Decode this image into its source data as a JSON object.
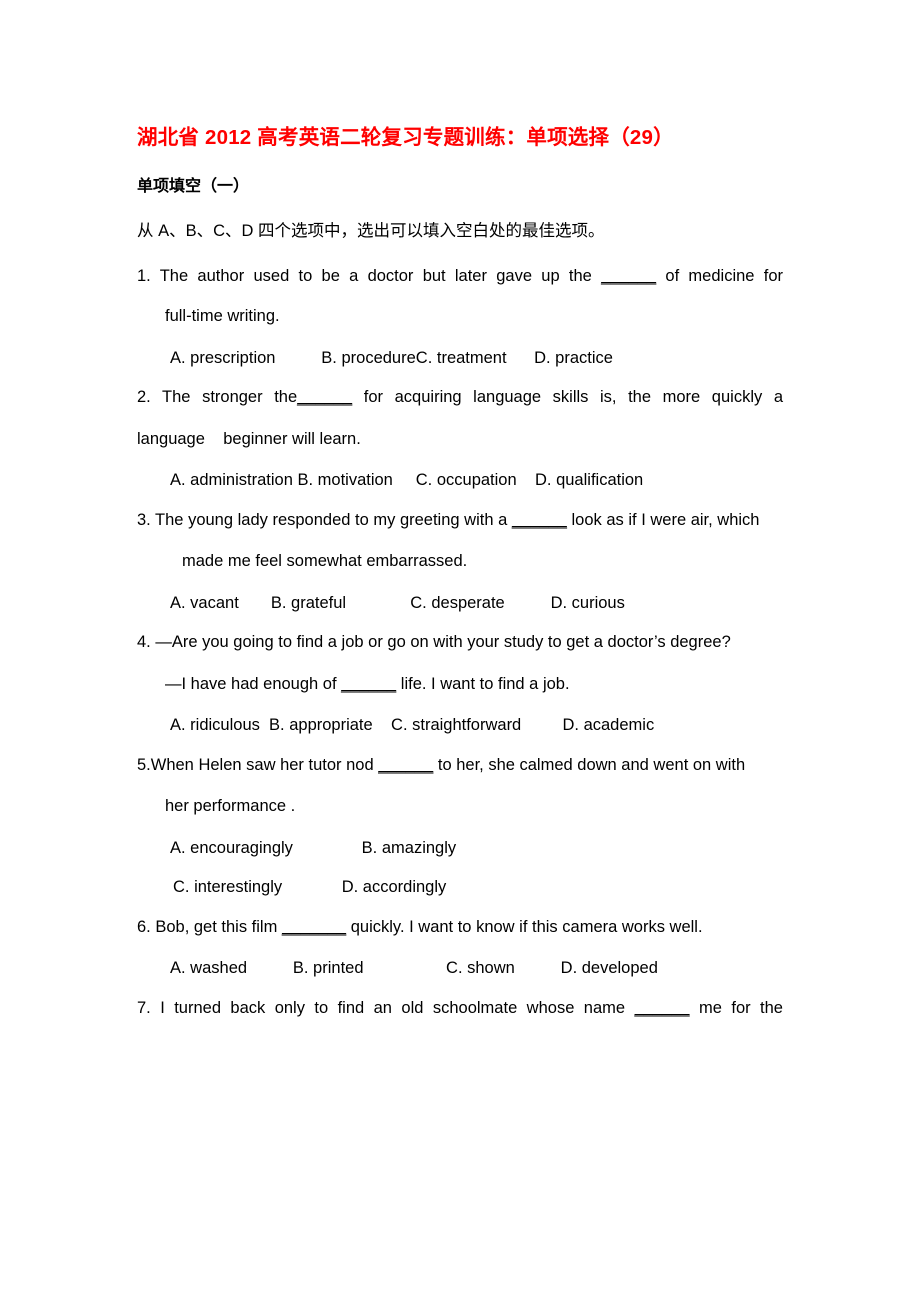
{
  "document": {
    "title": "湖北省 2012 高考英语二轮复习专题训练：单项选择（29）",
    "title_color": "#ff0000",
    "section_heading": "单项填空（一）",
    "instruction": "从 A、B、C、D 四个选项中，选出可以填入空白处的最佳选项。"
  },
  "questions": [
    {
      "number": "1.",
      "stem_line1": "1. The author used to be a doctor but later gave up the ______ of medicine for",
      "stem_line1_pre": "1. The author used to be a doctor but later gave up the ",
      "stem_line1_blank": "______",
      "stem_line1_post": " of medicine for",
      "stem_line2": "full-time writing.",
      "options_line1": "A. prescription          B. procedureC. treatment      D. practice"
    },
    {
      "number": "2.",
      "stem_line1_pre": "2. The stronger the",
      "stem_line1_blank": "______",
      "stem_line1_post": " for acquiring language skills is, the more quickly a",
      "stem_line2": "language    beginner will learn.",
      "options_line1": "A. administration B. motivation     C. occupation    D. qualification"
    },
    {
      "number": "3.",
      "stem_line1_pre": "3. The young lady responded to my greeting with a ",
      "stem_line1_blank": "______",
      "stem_line1_post": " look as if I were air, which",
      "stem_line2": "made me feel somewhat embarrassed.",
      "options_line1": "A. vacant       B. grateful              C. desperate          D. curious"
    },
    {
      "number": "4.",
      "stem_line1": "4. —Are you going to find a job or go on with your study to get a doctor’s degree?",
      "stem_line2_pre": "—I have had enough of ",
      "stem_line2_blank": "______",
      "stem_line2_post": " life. I want to find a job.",
      "options_line1": "A. ridiculous  B. appropriate    C. straightforward         D. academic"
    },
    {
      "number": "5.",
      "stem_line1_pre": "5.When Helen saw her tutor nod ",
      "stem_line1_blank": "______",
      "stem_line1_post": " to her, she calmed down and went on with",
      "stem_line2": "her performance .",
      "options_line1": "A. encouragingly               B. amazingly",
      "options_line2": "C. interestingly             D. accordingly"
    },
    {
      "number": "6.",
      "stem_line1_pre": "6. Bob, get this film ",
      "stem_line1_blank": "_______",
      "stem_line1_post": " quickly. I want to know if this camera works well.",
      "options_line1": "A. washed          B. printed                  C. shown          D. developed"
    },
    {
      "number": "7.",
      "stem_line1_pre": "7. I turned back only to find an old schoolmate whose name ",
      "stem_line1_blank": "______",
      "stem_line1_post": " me for the"
    }
  ]
}
